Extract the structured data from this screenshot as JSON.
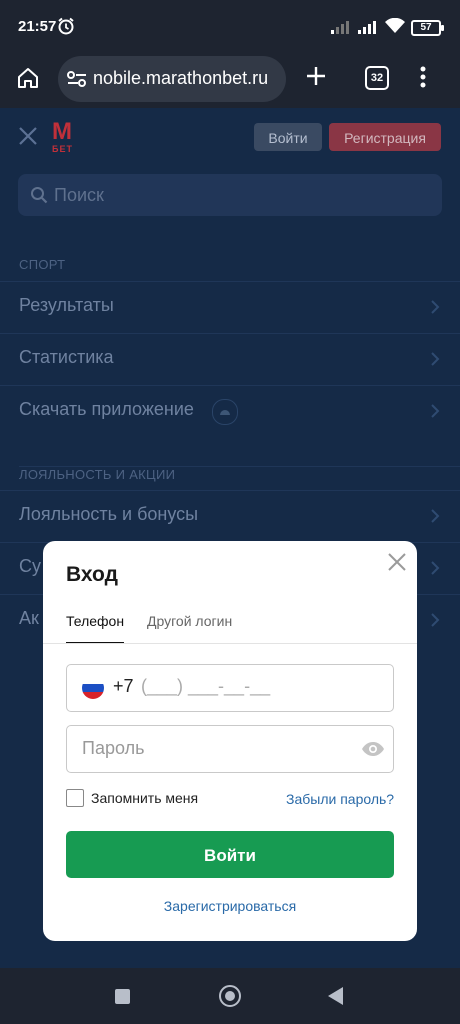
{
  "status_bar": {
    "time": "21:57",
    "battery": "57"
  },
  "browser": {
    "url": "nobile.marathonbet.ru",
    "tab_count": "32"
  },
  "site_header": {
    "logo_m": "M",
    "logo_bet": "БЕТ",
    "login_label": "Войти",
    "register_label": "Регистрация"
  },
  "search": {
    "placeholder": "Поиск"
  },
  "menu": {
    "sport_section": "СПОРТ",
    "sport_items": [
      {
        "label": "Результаты"
      },
      {
        "label": "Статистика"
      },
      {
        "label": "Скачать приложение"
      }
    ],
    "loyalty_section": "ЛОЯЛЬНОСТЬ И АКЦИИ",
    "loyalty_items": [
      {
        "label": "Лояльность и бонусы"
      },
      {
        "label": "Су"
      },
      {
        "label": "Ак"
      }
    ]
  },
  "login_modal": {
    "title": "Вход",
    "tabs": [
      {
        "label": "Телефон"
      },
      {
        "label": "Другой логин"
      }
    ],
    "phone_code": "+7",
    "phone_mask": "(___) ___-__-__",
    "password_placeholder": "Пароль",
    "remember_label": "Запомнить меня",
    "forgot_label": "Забыли пароль?",
    "submit_label": "Войти",
    "register_link": "Зарегистрироваться"
  },
  "colors": {
    "accent_green": "#179b52",
    "brand_red": "#c0303a",
    "link_blue": "#2a6aa8",
    "overlay_navy": "#152a47"
  },
  "icons": [
    "alarm-icon",
    "signal-icon",
    "wifi-icon",
    "home-icon",
    "site-settings-icon",
    "plus-icon",
    "more-icon",
    "close-icon",
    "search-icon",
    "chevron-right-icon",
    "eye-icon"
  ]
}
